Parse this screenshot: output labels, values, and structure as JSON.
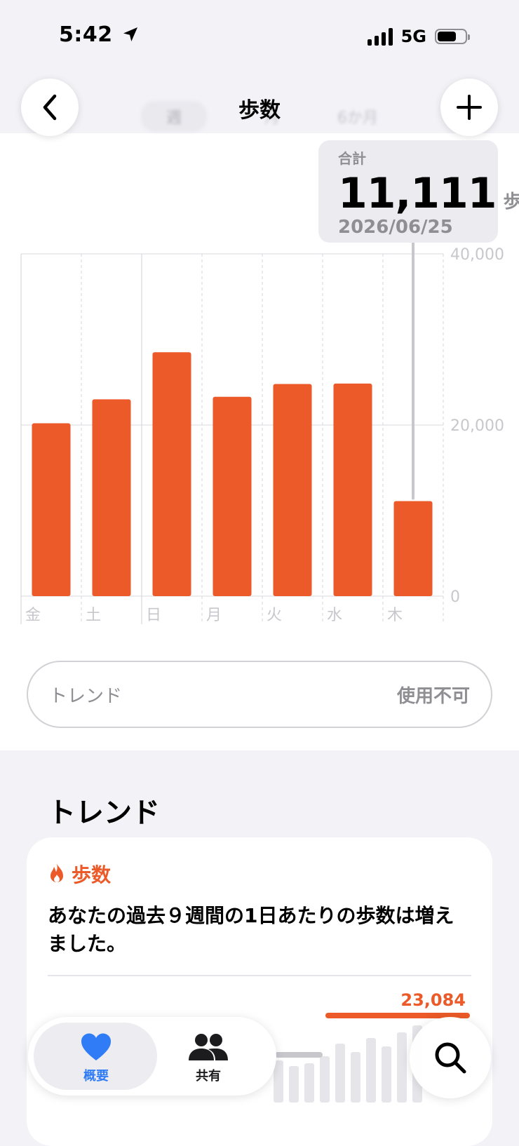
{
  "status_bar": {
    "time": "5:42",
    "network": "5G"
  },
  "nav": {
    "title": "歩数"
  },
  "segments": [
    "週",
    "月",
    "6か月"
  ],
  "tooltip": {
    "label": "合計",
    "value": "11,111",
    "unit": "歩",
    "date": "2026/06/25"
  },
  "chart_data": {
    "type": "bar",
    "categories": [
      "金",
      "土",
      "日",
      "月",
      "火",
      "水",
      "木"
    ],
    "values": [
      20200,
      23000,
      28500,
      23300,
      24800,
      24850,
      11111
    ],
    "ylim": [
      0,
      40000
    ],
    "y_ticks": [
      "0",
      "20,000",
      "40,000"
    ],
    "y_tick_values": [
      0,
      20000,
      40000
    ],
    "highlight_index": 6,
    "bar_color": "#eb5a28",
    "grid": true
  },
  "trend_field": {
    "label": "トレンド",
    "value": "使用不可"
  },
  "trend_section": {
    "title": "トレンド",
    "card_category": "歩数",
    "card_text": "あなたの過去９週間の1日あたりの歩数は増えました。",
    "card_value": "23,084"
  },
  "tabbar": {
    "summary_label": "概要",
    "share_label": "共有",
    "active_color": "#2f7cf6"
  },
  "icons": {
    "back": "chevron-left-icon",
    "add": "plus-icon",
    "flame": "flame-icon",
    "heart": "heart-icon",
    "people": "people-icon",
    "search": "search-icon"
  }
}
